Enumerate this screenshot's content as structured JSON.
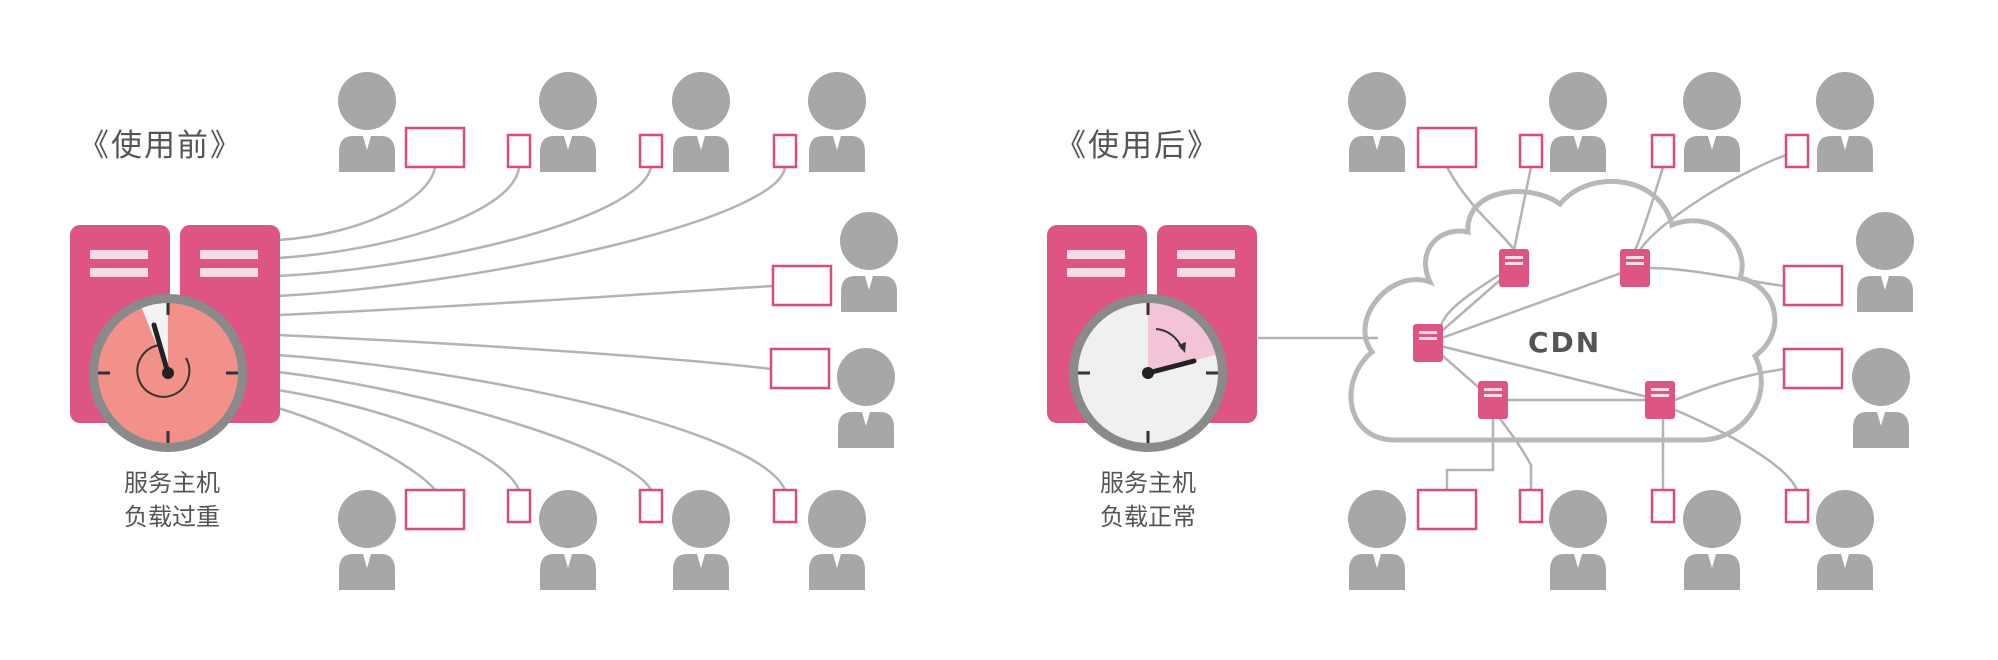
{
  "before": {
    "title": "《使用前》",
    "server_label_line1": "服务主机",
    "server_label_line2": "负载过重"
  },
  "after": {
    "title": "《使用后》",
    "server_label_line1": "服务主机",
    "server_label_line2": "负载正常",
    "cloud_label": "CDN"
  },
  "colors": {
    "server": "#de5485",
    "server_stripe": "#f6dbe6",
    "clock_ring": "#8a8a8a",
    "clock_face_overloaded": "#f2908a",
    "clock_face_normal": "#f0f0f0",
    "clock_wedge_normal": "#f3c4d8",
    "person": "#a7a7a7",
    "device_outline": "#d94c7c",
    "line": "#b3b3b3",
    "cdn_node": "#de5485",
    "cloud_outline": "#b8b8b8"
  }
}
